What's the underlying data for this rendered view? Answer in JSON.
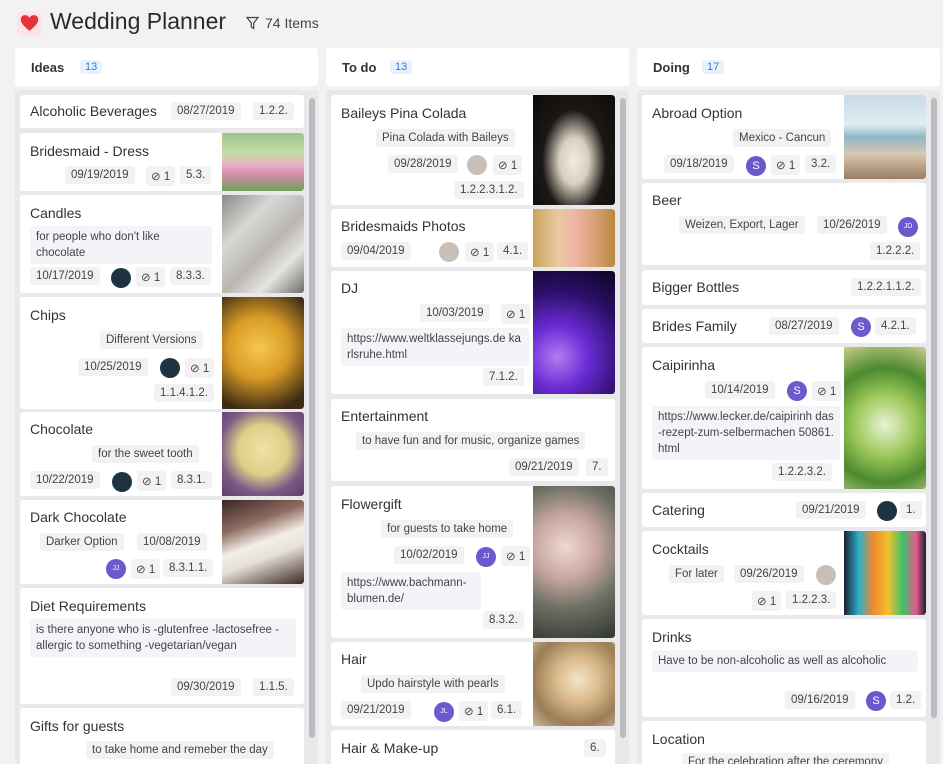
{
  "app": {
    "title": "Wedding Planner",
    "items_count": "74 Items",
    "icon": "heart-icon",
    "accent": "#e5313d"
  },
  "lanes": [
    {
      "name": "Ideas",
      "count": "13"
    },
    {
      "name": "To do",
      "count": "13"
    },
    {
      "name": "Doing",
      "count": "17"
    }
  ],
  "ideas": [
    {
      "title": "Alcoholic Beverages",
      "date": "08/27/2019",
      "id": "1.2.2."
    },
    {
      "title": "Bridesmaid - Dress",
      "date": "09/19/2019",
      "att": "1",
      "id": "5.3.",
      "image": "bridesmaids-photo"
    },
    {
      "title": "Candles",
      "desc": "for people who don't like chocolate",
      "date": "10/17/2019",
      "att": "1",
      "id": "8.3.3.",
      "image": "candles-photo"
    },
    {
      "title": "Chips",
      "desc": "Different Versions",
      "date": "10/25/2019",
      "att": "1",
      "id": "1.1.4.1.2.",
      "image": "chips-photo"
    },
    {
      "title": "Chocolate",
      "desc": "for the sweet tooth",
      "date": "10/22/2019",
      "att": "1",
      "id": "8.3.1.",
      "image": "chocolate-photo"
    },
    {
      "title": "Dark Chocolate",
      "desc": "Darker Option",
      "date": "10/08/2019",
      "avatar": "JJ",
      "att": "1",
      "id": "8.3.1.1.",
      "image": "dark-chocolate-photo"
    },
    {
      "title": "Diet Requirements",
      "desc": "is there anyone who is -glutenfree -lactosefree -allergic to something -vegetarian/vegan",
      "date": "09/30/2019",
      "id": "1.1.5."
    },
    {
      "title": "Gifts for guests",
      "desc": "to take home and remeber the day"
    }
  ],
  "todo": [
    {
      "title": "Baileys Pina Colada",
      "desc": "Pina Colada with Baileys",
      "date": "09/28/2019",
      "att": "1",
      "id": "1.2.2.3.1.2.",
      "image": "pina-colada-photo"
    },
    {
      "title": "Bridesmaids Photos",
      "date": "09/04/2019",
      "att": "1",
      "id": "4.1.",
      "image": "bridesmaids-photos-photo"
    },
    {
      "title": "DJ",
      "date": "10/03/2019",
      "att": "1",
      "link": "https://www.weltklassejungs.de karlsruhe.html",
      "id": "7.1.2.",
      "image": "dj-photo"
    },
    {
      "title": "Entertainment",
      "desc": "to have fun and for music, organize games",
      "date": "09/21/2019",
      "id": "7."
    },
    {
      "title": "Flowergift",
      "desc": "for guests to take home",
      "date": "10/02/2019",
      "avatar": "JJ",
      "att": "1",
      "link": "https://www.bachmann-blumen.de/",
      "id": "8.3.2.",
      "image": "flowers-photo"
    },
    {
      "title": "Hair",
      "desc": "Updo hairstyle with pearls",
      "date": "09/21/2019",
      "avatar": "JL",
      "att": "1",
      "id": "6.1.",
      "image": "hair-photo"
    },
    {
      "title": "Hair & Make-up",
      "id": "6."
    }
  ],
  "doing": [
    {
      "title": "Abroad Option",
      "desc": "Mexico - Cancun",
      "date": "09/18/2019",
      "avatar": "S",
      "att": "1",
      "id": "3.2.",
      "image": "beach-photo"
    },
    {
      "title": "Beer",
      "desc": "Weizen, Export, Lager",
      "date": "10/26/2019",
      "avatar": "JD",
      "id": "1.2.2.2."
    },
    {
      "title": "Bigger Bottles",
      "id": "1.2.2.1.1.2."
    },
    {
      "title": "Brides Family",
      "date": "08/27/2019",
      "avatar": "S",
      "id": "4.2.1."
    },
    {
      "title": "Caipirinha",
      "date": "10/14/2019",
      "avatar": "S",
      "att": "1",
      "link": "https://www.lecker.de/caipirinh das-rezept-zum-selbermachen 50861.html",
      "id": "1.2.2.3.2.",
      "image": "caipirinha-photo"
    },
    {
      "title": "Catering",
      "date": "09/21/2019",
      "id": "1."
    },
    {
      "title": "Cocktails",
      "desc": "For later",
      "date": "09/26/2019",
      "att": "1",
      "id": "1.2.2.3.",
      "image": "cocktails-photo"
    },
    {
      "title": "Drinks",
      "desc": "Have to be non-alcoholic as well as alcoholic",
      "date": "09/16/2019",
      "avatar": "S",
      "id": "1.2."
    },
    {
      "title": "Location",
      "desc": "For the celebration after the ceremony"
    }
  ]
}
